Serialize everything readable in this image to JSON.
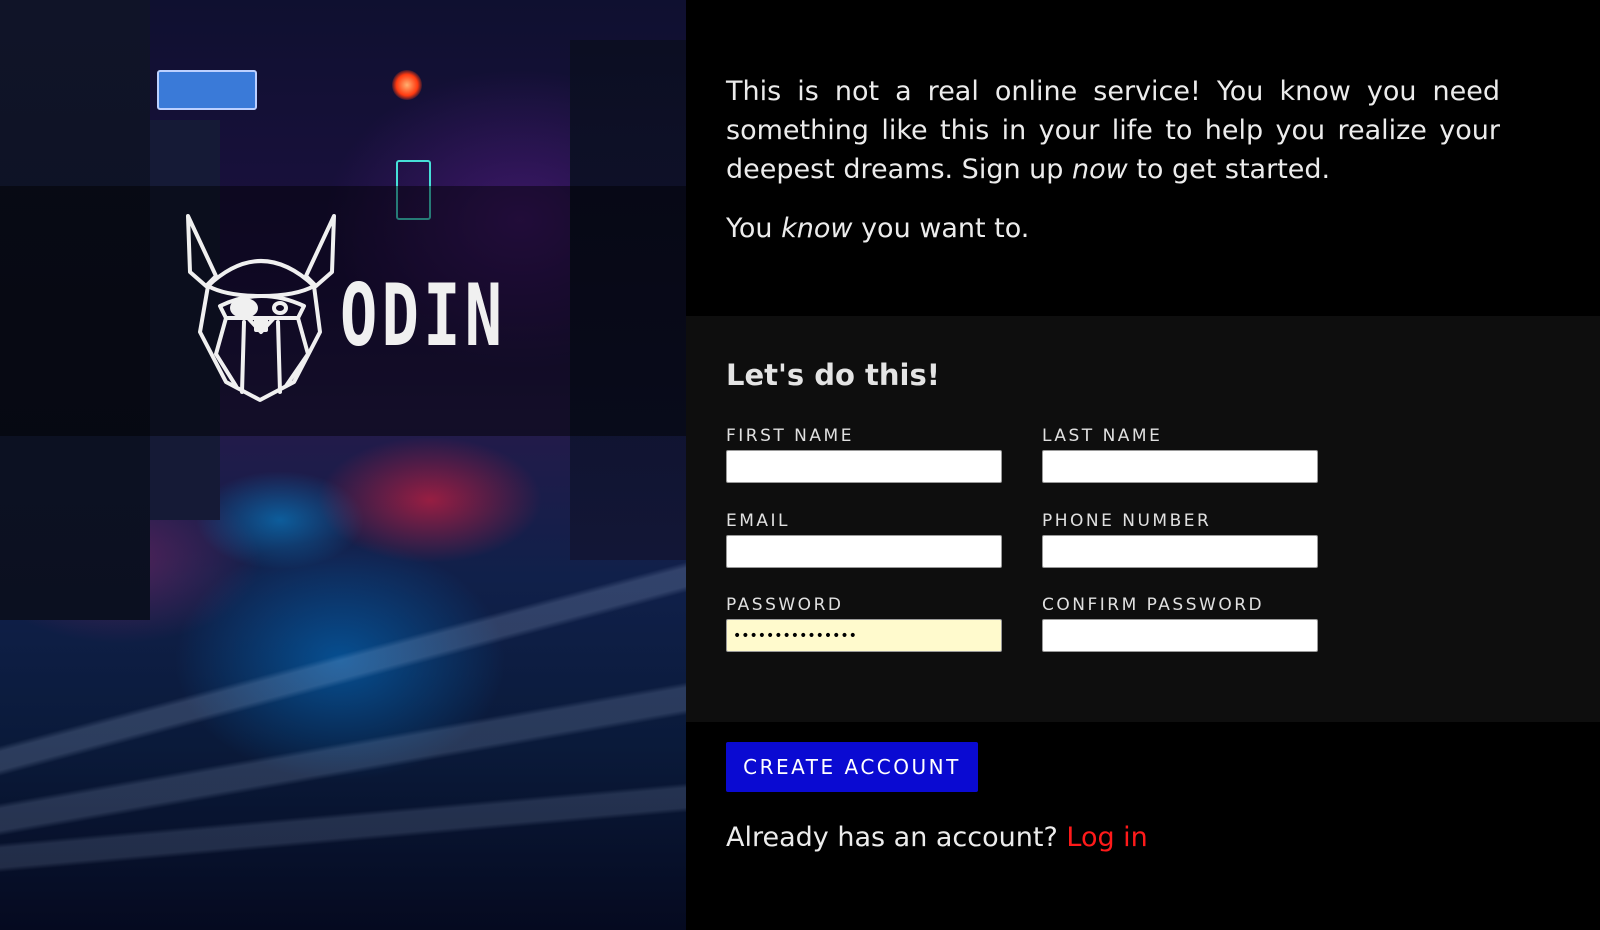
{
  "hero": {
    "logo_text": "ODIN",
    "logo_icon": "viking-helmet-icon"
  },
  "intro": {
    "lead_part1": "This is not a real online service! You know you need something like this in your life to help you realize your deepest dreams. Sign up ",
    "lead_emphasis": "now",
    "lead_part2": " to get started.",
    "second_part1": "You ",
    "second_emphasis": "know",
    "second_part2": " you want to."
  },
  "form": {
    "title": "Let's do this!",
    "fields": [
      {
        "label": "FIRST NAME",
        "value": ""
      },
      {
        "label": "LAST NAME",
        "value": ""
      },
      {
        "label": "EMAIL",
        "value": ""
      },
      {
        "label": "PHONE NUMBER",
        "value": ""
      },
      {
        "label": "PASSWORD",
        "value": "•••••••••••••••"
      },
      {
        "label": "CONFIRM PASSWORD",
        "value": ""
      }
    ]
  },
  "actions": {
    "create_label": "CREATE ACCOUNT",
    "login_prompt": "Already has an account? ",
    "login_link": "Log in"
  },
  "colors": {
    "button_bg": "#0a0ad2",
    "link": "#ff1a1a",
    "form_panel_bg": "#0e0e0e",
    "autofill_bg": "#fffacd"
  }
}
